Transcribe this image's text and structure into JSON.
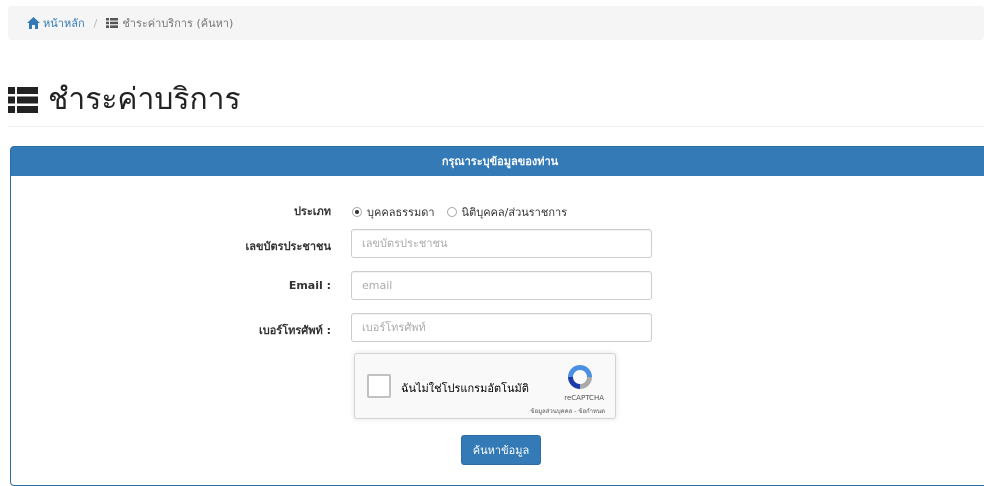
{
  "breadcrumb": {
    "home_label": "หน้าหลัก",
    "separator": "/",
    "current_label": "ชำระค่าบริการ (ค้นหา)"
  },
  "page": {
    "title": "ชำระค่าบริการ"
  },
  "panel": {
    "heading": "กรุณาระบุข้อมูลของท่าน"
  },
  "form": {
    "type_label": "ประเภท",
    "type_options": [
      {
        "label": "บุคคลธรรมดา",
        "selected": true
      },
      {
        "label": "นิติบุคคล/ส่วนราชการ",
        "selected": false
      }
    ],
    "id_label": "เลขบัตรประชาชน",
    "id_placeholder": "เลขบัตรประชาชน",
    "email_label": "Email :",
    "email_placeholder": "email",
    "phone_label": "เบอร์โทรศัพท์ :",
    "phone_placeholder": "เบอร์โทรศัพท์"
  },
  "recaptcha": {
    "label": "ฉันไม่ใช่โปรแกรมอัตโนมัติ",
    "brand": "reCAPTCHA",
    "links": "ข้อมูลส่วนบุคคล - ข้อกำหนด",
    "checked": false
  },
  "actions": {
    "search_label": "ค้นหาข้อมูล"
  },
  "colors": {
    "primary": "#337ab7",
    "primary_border": "#2e6da4",
    "breadcrumb_bg": "#f5f5f5"
  },
  "icons": {
    "home": "home-icon",
    "list": "list-icon"
  }
}
